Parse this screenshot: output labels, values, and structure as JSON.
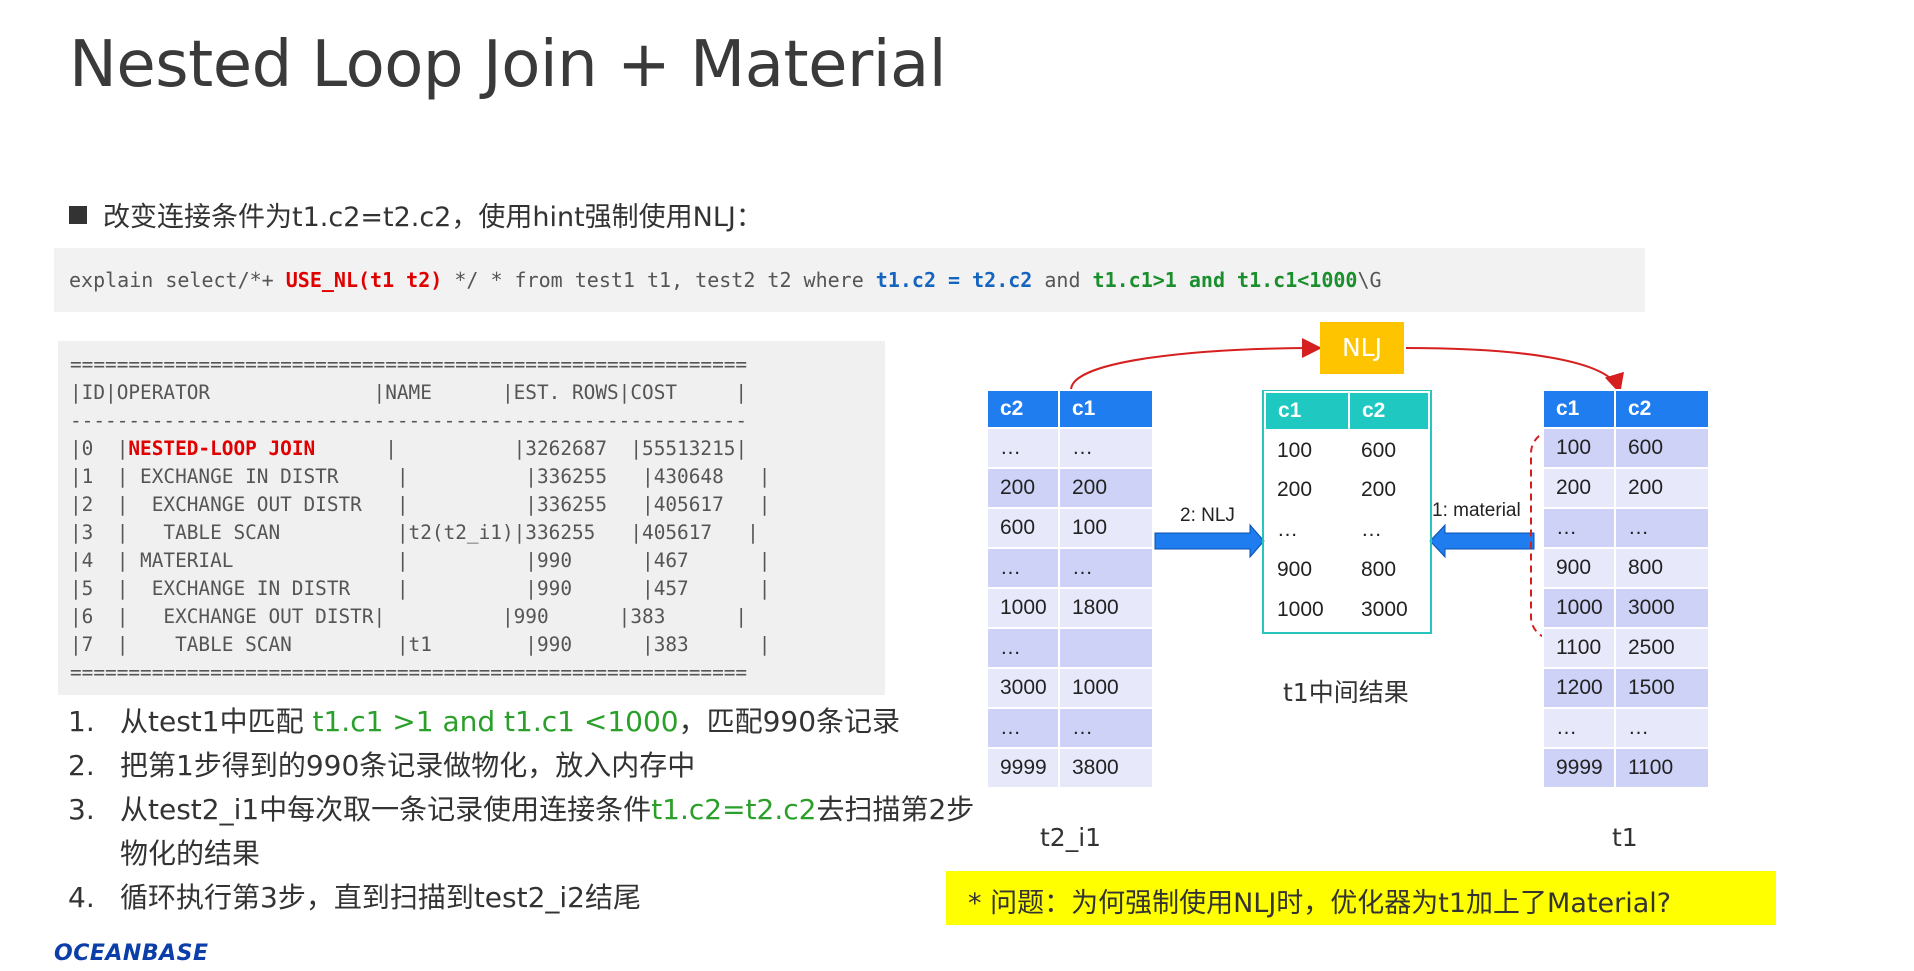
{
  "title": "Nested Loop Join + Material",
  "bullet": "改变连接条件为t1.c2=t2.c2，使用hint强制使用NLJ：",
  "sql": {
    "p1": "explain select/*+ ",
    "hint": "USE_NL(t1 t2)",
    "p2": " */ * from test1 t1, test2 t2 where ",
    "cond": "t1.c2 = t2.c2",
    "p3": " and ",
    "filter": "t1.c1>1 and t1.c1<1000",
    "p4": "\\G"
  },
  "plan": {
    "sep_eq": "==========================================================",
    "header": "|ID|OPERATOR              |NAME      |EST. ROWS|COST     |",
    "sep_dash": "----------------------------------------------------------",
    "row0_prefix": "|0  |",
    "row0_op": "NESTED-LOOP JOIN",
    "row0_suffix": "      |          |3262687  |55513215|",
    "rows": [
      "|1  | EXCHANGE IN DISTR     |          |336255   |430648   |",
      "|2  |  EXCHANGE OUT DISTR   |          |336255   |405617   |",
      "|3  |   TABLE SCAN          |t2(t2_i1)|336255   |405617   |",
      "|4  | MATERIAL              |          |990      |467      |",
      "|5  |  EXCHANGE IN DISTR    |          |990      |457      |",
      "|6  |   EXCHANGE OUT DISTR|          |990      |383      |",
      "|7  |    TABLE SCAN         |t1        |990      |383      |"
    ]
  },
  "steps": [
    {
      "num": "1.",
      "a": "从test1中匹配 ",
      "g": "t1.c1 >1 and t1.c1 <1000",
      "b": "，匹配990条记录"
    },
    {
      "num": "2.",
      "a": "把第1步得到的990条记录做物化，放入内存中",
      "g": "",
      "b": ""
    },
    {
      "num": "3.",
      "a": "从test2_i1中每次取一条记录使用连接条件",
      "g": "t1.c2=t2.c2",
      "b": "去扫描第2步物化的结果"
    },
    {
      "num": "4.",
      "a": "循环执行第3步，直到扫描到test2_i2结尾",
      "g": "",
      "b": ""
    }
  ],
  "diagram": {
    "nlj_box": "NLJ",
    "arrow1": "1: material",
    "arrow2": "2: NLJ",
    "t2_caption": "t2_i1",
    "mid_caption": "t1中间结果",
    "t1_caption": "t1",
    "t2_table": {
      "headers": [
        "c2",
        "c1"
      ],
      "rows": [
        [
          "…",
          "…"
        ],
        [
          "200",
          "200"
        ],
        [
          "600",
          "100"
        ],
        [
          "…",
          "…"
        ],
        [
          "1000",
          "1800"
        ],
        [
          "…",
          ""
        ],
        [
          "3000",
          "1000"
        ],
        [
          "…",
          "…"
        ],
        [
          "9999",
          "3800"
        ]
      ]
    },
    "mid_table": {
      "headers": [
        "c1",
        "c2"
      ],
      "rows": [
        [
          "100",
          "600"
        ],
        [
          "200",
          "200"
        ],
        [
          "…",
          "…"
        ],
        [
          "900",
          "800"
        ],
        [
          "1000",
          "3000"
        ]
      ]
    },
    "t1_table": {
      "headers": [
        "c1",
        "c2"
      ],
      "rows": [
        [
          "100",
          "600"
        ],
        [
          "200",
          "200"
        ],
        [
          "…",
          "…"
        ],
        [
          "900",
          "800"
        ],
        [
          "1000",
          "3000"
        ],
        [
          "1100",
          "2500"
        ],
        [
          "1200",
          "1500"
        ],
        [
          "…",
          "…"
        ],
        [
          "9999",
          "1100"
        ]
      ]
    }
  },
  "question": "* 问题：为何强制使用NLJ时，优化器为t1加上了Material?",
  "logo": "OCEANBASE",
  "colors": {
    "hint_red": "#e00000",
    "cond_blue": "#1565c0",
    "filter_green": "#1b8f2e",
    "table_header_blue": "#1f7df0",
    "mid_header_teal": "#1fc8c0",
    "nlj_box_orange": "#ffc400",
    "question_yellow": "#ffff00"
  }
}
